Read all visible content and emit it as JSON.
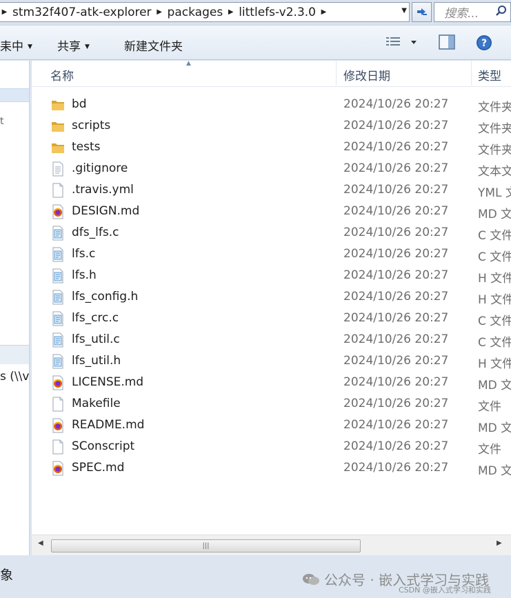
{
  "address_bar": {
    "crumbs": [
      "stm32f407-atk-explorer",
      "packages",
      "littlefs-v2.3.0"
    ]
  },
  "search": {
    "placeholder": "搜索..."
  },
  "toolbar": {
    "organize_label": "耒中",
    "share_label": "共享",
    "new_folder_label": "新建文件夹"
  },
  "nav": {
    "network_item": "s (\\\\vr",
    "mark": "t"
  },
  "columns": {
    "name": "名称",
    "date": "修改日期",
    "type": "类型"
  },
  "files": [
    {
      "name": "bd",
      "date": "2024/10/26 20:27",
      "type": "文件夹",
      "icon": "folder"
    },
    {
      "name": "scripts",
      "date": "2024/10/26 20:27",
      "type": "文件夹",
      "icon": "folder"
    },
    {
      "name": "tests",
      "date": "2024/10/26 20:27",
      "type": "文件夹",
      "icon": "folder"
    },
    {
      "name": ".gitignore",
      "date": "2024/10/26 20:27",
      "type": "文本文",
      "icon": "text"
    },
    {
      "name": ".travis.yml",
      "date": "2024/10/26 20:27",
      "type": "YML 文",
      "icon": "blank"
    },
    {
      "name": "DESIGN.md",
      "date": "2024/10/26 20:27",
      "type": "MD 文",
      "icon": "firefox"
    },
    {
      "name": "dfs_lfs.c",
      "date": "2024/10/26 20:27",
      "type": "C 文件",
      "icon": "code"
    },
    {
      "name": "lfs.c",
      "date": "2024/10/26 20:27",
      "type": "C 文件",
      "icon": "code"
    },
    {
      "name": "lfs.h",
      "date": "2024/10/26 20:27",
      "type": "H 文件",
      "icon": "code"
    },
    {
      "name": "lfs_config.h",
      "date": "2024/10/26 20:27",
      "type": "H 文件",
      "icon": "code"
    },
    {
      "name": "lfs_crc.c",
      "date": "2024/10/26 20:27",
      "type": "C 文件",
      "icon": "code"
    },
    {
      "name": "lfs_util.c",
      "date": "2024/10/26 20:27",
      "type": "C 文件",
      "icon": "code"
    },
    {
      "name": "lfs_util.h",
      "date": "2024/10/26 20:27",
      "type": "H 文件",
      "icon": "code"
    },
    {
      "name": "LICENSE.md",
      "date": "2024/10/26 20:27",
      "type": "MD 文",
      "icon": "firefox"
    },
    {
      "name": "Makefile",
      "date": "2024/10/26 20:27",
      "type": "文件",
      "icon": "blank"
    },
    {
      "name": "README.md",
      "date": "2024/10/26 20:27",
      "type": "MD 文",
      "icon": "firefox"
    },
    {
      "name": "SConscript",
      "date": "2024/10/26 20:27",
      "type": "文件",
      "icon": "blank"
    },
    {
      "name": "SPEC.md",
      "date": "2024/10/26 20:27",
      "type": "MD 文",
      "icon": "firefox"
    }
  ],
  "status": {
    "text": "象"
  },
  "watermark": {
    "main": "公众号 · 嵌入式学习与实践",
    "sub": "CSDN @嵌入式学习和实践"
  },
  "colors": {
    "folder": "#e8b84a",
    "firefox": "#e66000",
    "code_accent": "#5a9bd5",
    "selection": "#dce8f6"
  }
}
